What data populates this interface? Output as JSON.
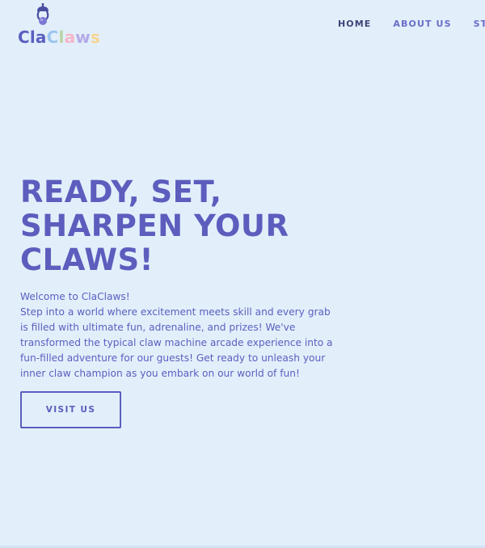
{
  "brand": {
    "logo_prefix": "Cla",
    "logo_suffix_letters": [
      "C",
      "l",
      "a",
      "w",
      "s"
    ],
    "logo_icon": "claw-icon"
  },
  "nav": {
    "items": [
      {
        "label": "HOME",
        "active": true
      },
      {
        "label": "ABOUT US",
        "active": false
      },
      {
        "label": "STUD",
        "active": false
      }
    ]
  },
  "hero": {
    "title_lines": [
      "READY, SET,",
      "SHARPEN YOUR",
      "CLAWS!"
    ],
    "intro_lines": [
      "Welcome to ClaClaws!",
      "Step into a world where excitement meets skill and every grab is filled with ultimate fun, adrenaline, and prizes! We've transformed the typical claw machine arcade experience into a fun-filled adventure for our guests! Get ready to unleash your inner claw champion as you embark on our world of fun!"
    ],
    "cta_label": "VISIT US"
  },
  "colors": {
    "background": "#e2effb",
    "primary": "#5c5dbd",
    "nav_active": "#3f4377",
    "nav": "#6a6ec9"
  }
}
